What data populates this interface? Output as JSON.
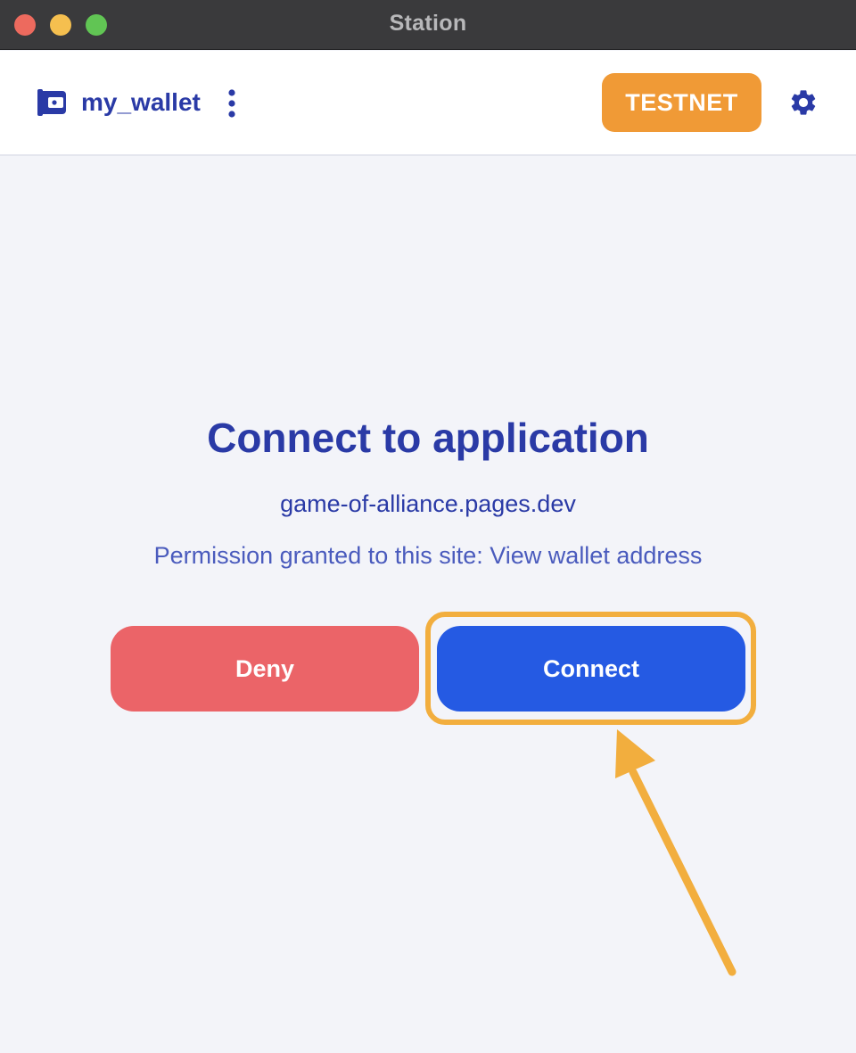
{
  "window": {
    "title": "Station"
  },
  "header": {
    "wallet_name": "my_wallet",
    "network_badge": "TESTNET",
    "icons": {
      "wallet": "wallet-icon",
      "menu": "more-vertical-icon",
      "settings": "gear-icon"
    }
  },
  "main": {
    "heading": "Connect to application",
    "site": "game-of-alliance.pages.dev",
    "permission": "Permission granted to this site: View wallet address",
    "deny_label": "Deny",
    "connect_label": "Connect"
  },
  "annotation": {
    "highlight_target": "connect-button",
    "color": "#f2ae3e"
  },
  "colors": {
    "primary_text": "#2a3aa6",
    "testnet_badge": "#f09a36",
    "deny_button": "#eb6468",
    "connect_button": "#255ae3",
    "background": "#f3f4f9"
  }
}
